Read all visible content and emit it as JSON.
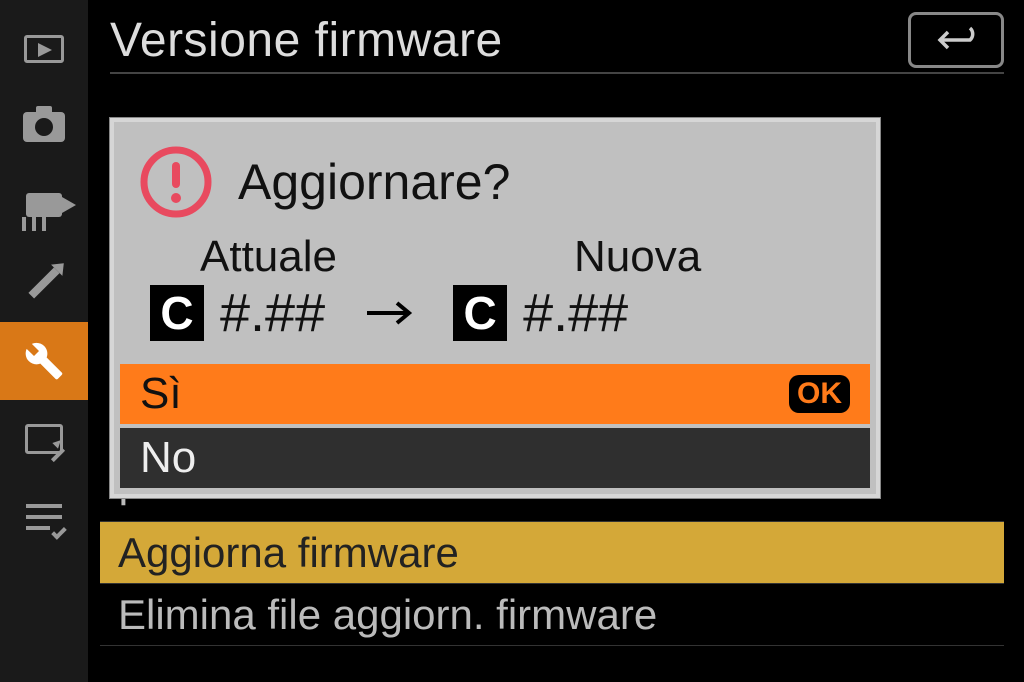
{
  "header": {
    "title": "Versione firmware"
  },
  "sidebar": {
    "items": [
      "playback",
      "photo",
      "video",
      "pencil",
      "setup",
      "retouch",
      "mymenu"
    ],
    "active_index": 4
  },
  "background_menu": {
    "partial_row": "F",
    "highlight_row": "Aggiorna firmware",
    "last_row": "Elimina file aggiorn. firmware"
  },
  "dialog": {
    "title": "Aggiornare?",
    "current_label": "Attuale",
    "new_label": "Nuova",
    "badge": "C",
    "current_version": "#.##",
    "new_version": "#.##",
    "option_yes": "Sì",
    "option_no": "No",
    "ok_label": "OK"
  }
}
